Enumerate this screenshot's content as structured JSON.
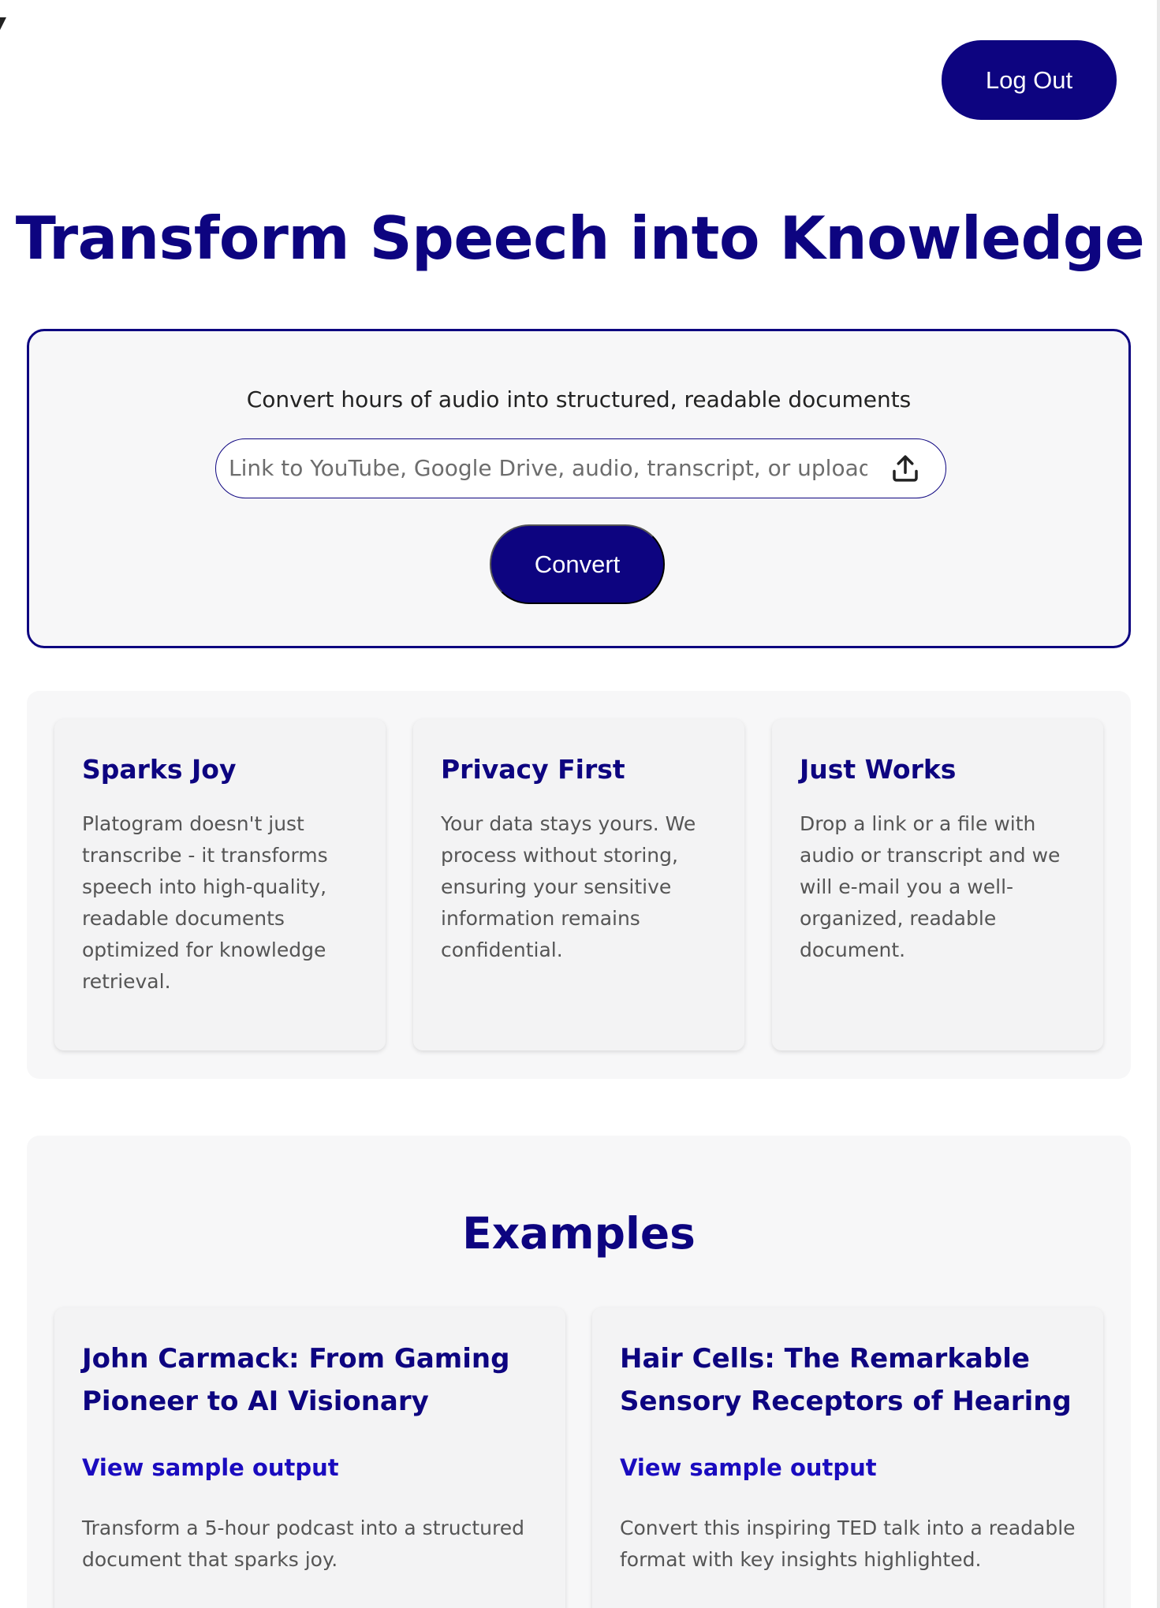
{
  "header": {
    "logout_label": "Log Out"
  },
  "hero": {
    "title": "Transform Speech into Knowledge"
  },
  "converter": {
    "subtitle": "Convert hours of audio into structured, readable documents",
    "input_placeholder": "Link to YouTube, Google Drive, audio, transcript, or upload",
    "input_value": "",
    "upload_icon": "upload-icon",
    "convert_label": "Convert"
  },
  "features": [
    {
      "title": "Sparks Joy",
      "body": "Platogram doesn't just transcribe - it transforms speech into high-quality, readable documents optimized for knowledge retrieval."
    },
    {
      "title": "Privacy First",
      "body": "Your data stays yours. We process without storing, ensuring your sensitive information remains confidential."
    },
    {
      "title": "Just Works",
      "body": "Drop a link or a file with audio or transcript and we will e-mail you a well-organized, readable document."
    }
  ],
  "examples": {
    "title": "Examples",
    "items": [
      {
        "title": "John Carmack: From Gaming Pioneer to AI Visionary",
        "link_label": "View sample output",
        "description": "Transform a 5-hour podcast into a structured document that sparks joy."
      },
      {
        "title": "Hair Cells: The Remarkable Sensory Receptors of Hearing",
        "link_label": "View sample output",
        "description": "Convert this inspiring TED talk into a readable format with key insights highlighted."
      }
    ]
  },
  "colors": {
    "brand": "#0d0480",
    "link": "#1a0bbf",
    "panel": "#f7f7f8"
  }
}
